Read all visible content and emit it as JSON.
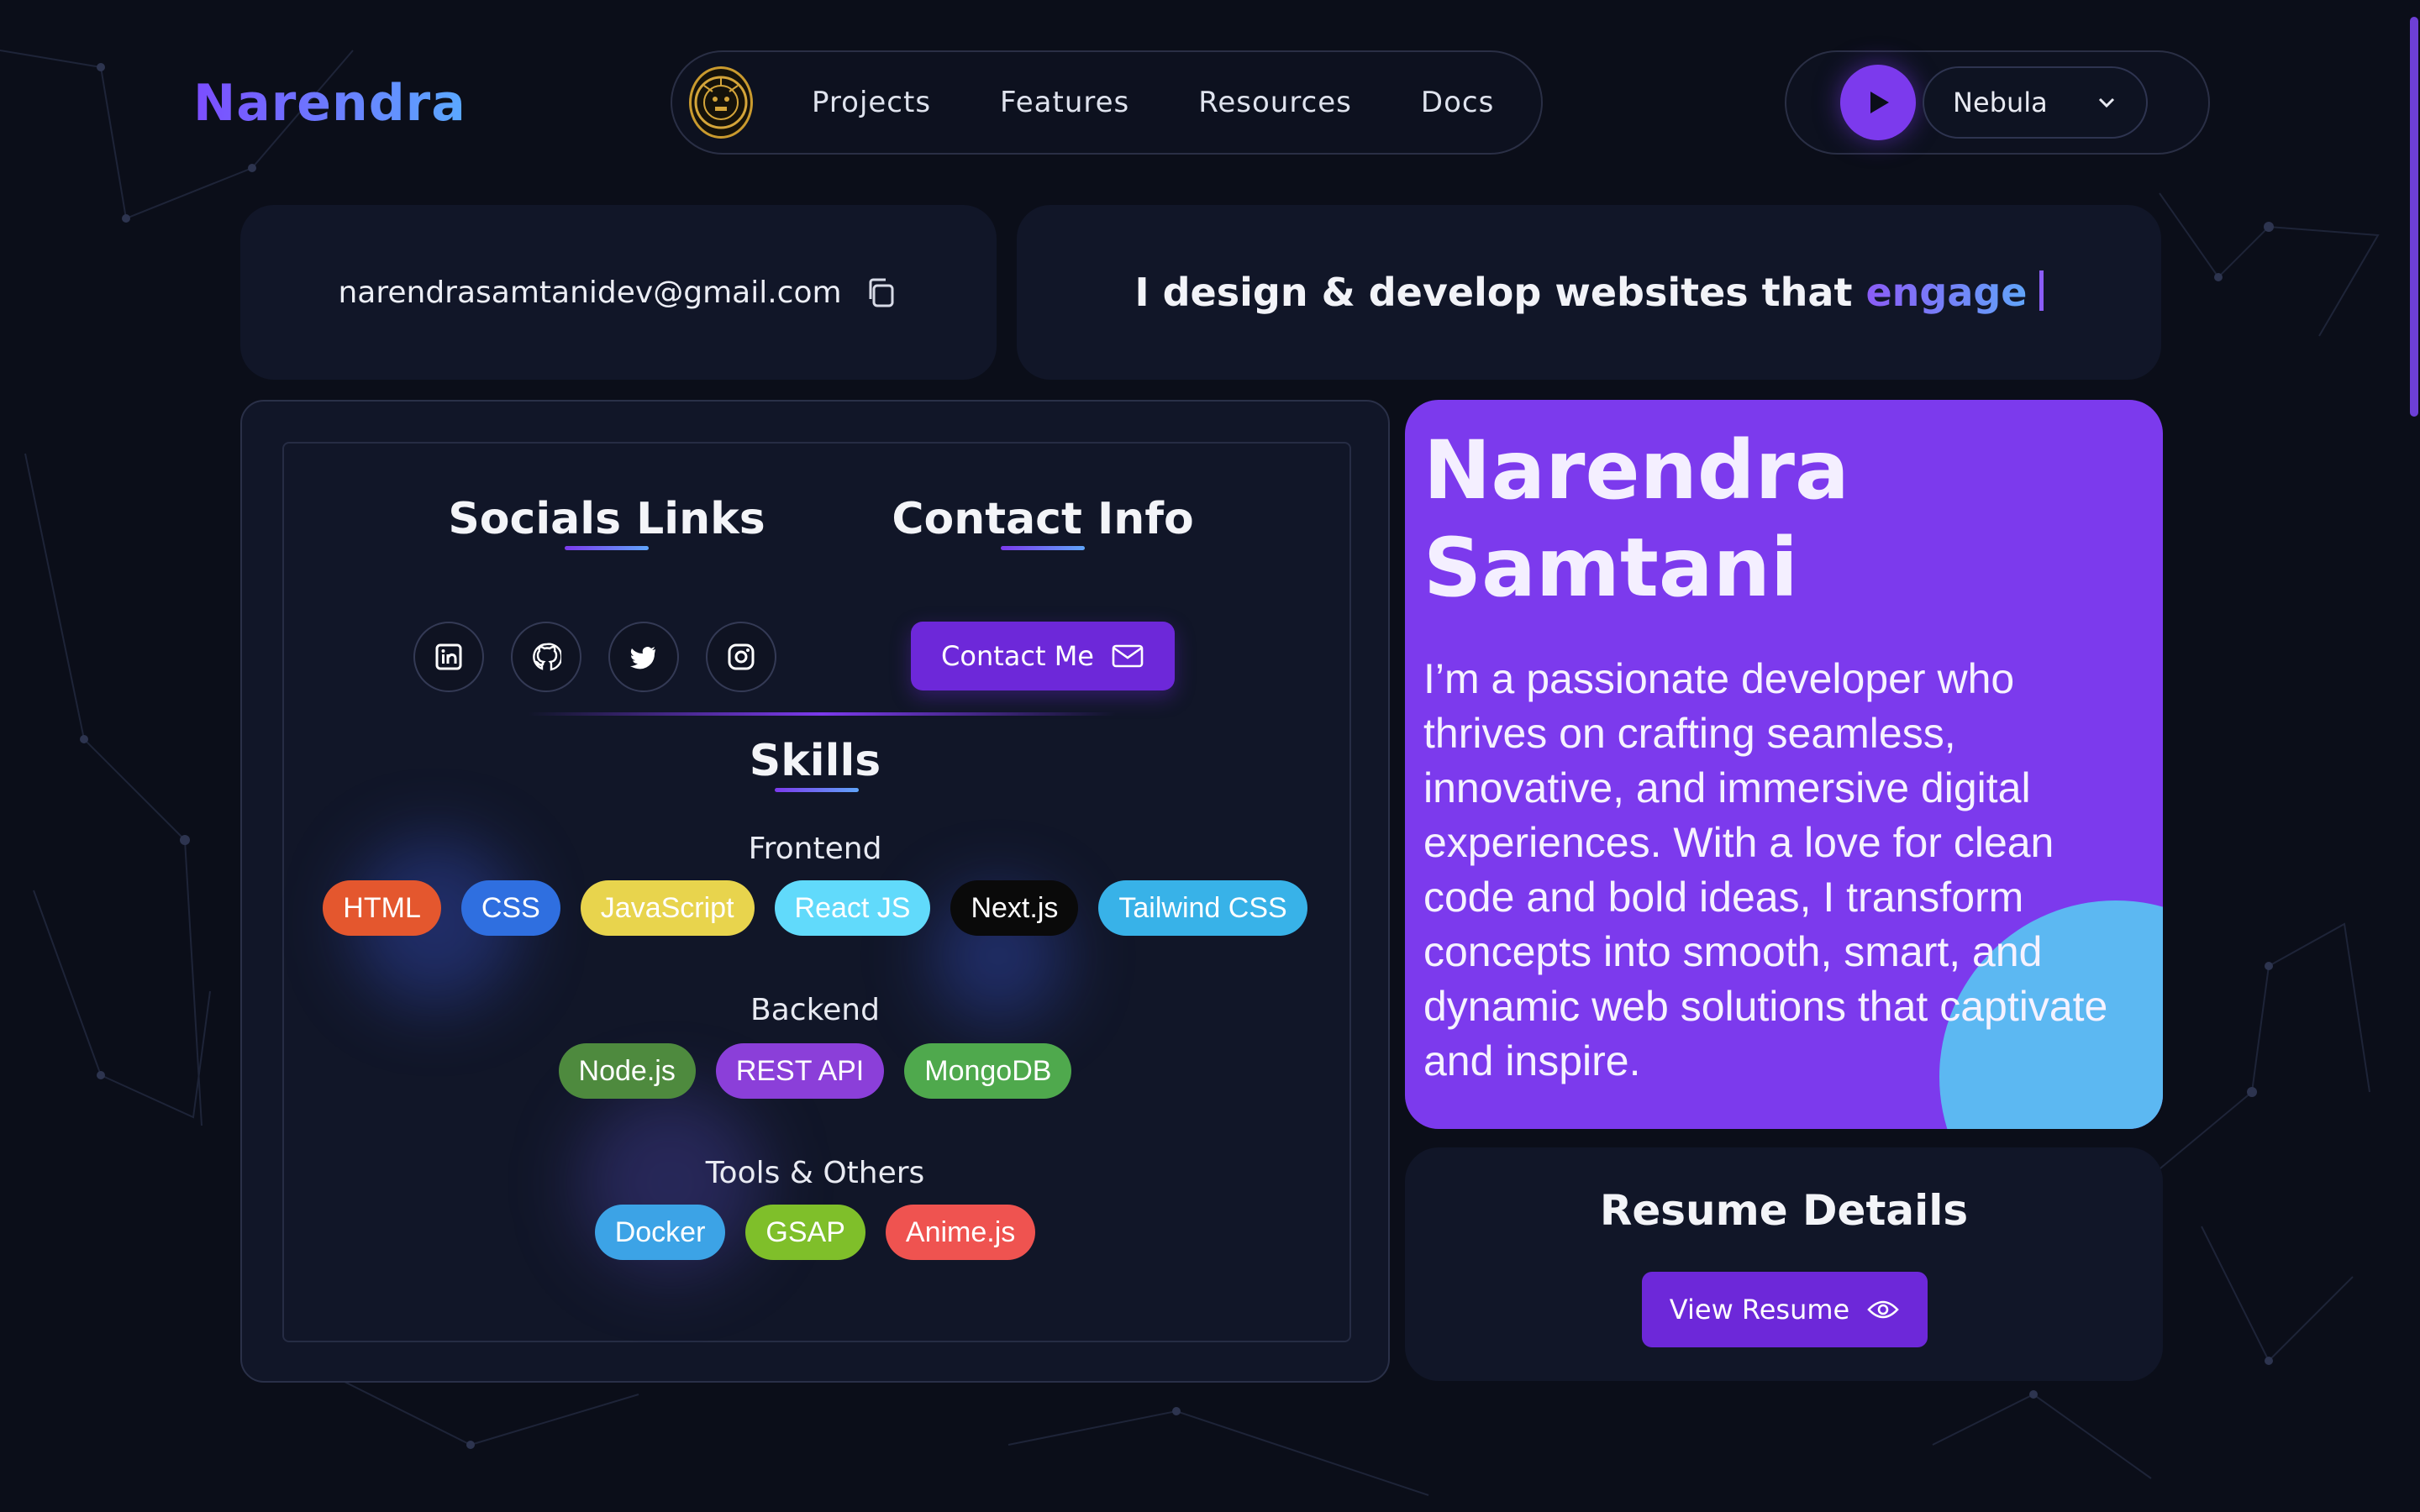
{
  "brand": {
    "logo_text": "Narendra"
  },
  "nav": {
    "items": [
      "Projects",
      "Features",
      "Resources",
      "Docs"
    ]
  },
  "player": {
    "theme_selected": "Nebula"
  },
  "email": {
    "address": "narendrasamtanidev@gmail.com"
  },
  "tagline": {
    "text": "I design & develop websites that ",
    "highlight": "engage"
  },
  "socials": {
    "title": "Socials Links",
    "icons": [
      "linkedin-icon",
      "github-icon",
      "twitter-icon",
      "instagram-icon"
    ]
  },
  "contact": {
    "title": "Contact Info",
    "button_label": "Contact Me"
  },
  "skills": {
    "title": "Skills",
    "groups": [
      {
        "label": "Frontend",
        "tags": [
          {
            "name": "HTML",
            "color": "#e4572e"
          },
          {
            "name": "CSS",
            "color": "#2f6fe0"
          },
          {
            "name": "JavaScript",
            "color": "#e8d44d"
          },
          {
            "name": "React JS",
            "color": "#61dafb"
          },
          {
            "name": "Next.js",
            "color": "#0a0a0a"
          },
          {
            "name": "Tailwind CSS",
            "color": "#38b2e8"
          }
        ]
      },
      {
        "label": "Backend",
        "tags": [
          {
            "name": "Node.js",
            "color": "#4e8a3e"
          },
          {
            "name": "REST API",
            "color": "#8b3fd9"
          },
          {
            "name": "MongoDB",
            "color": "#4fa94d"
          }
        ]
      },
      {
        "label": "Tools & Others",
        "tags": [
          {
            "name": "Docker",
            "color": "#3ca3e6"
          },
          {
            "name": "GSAP",
            "color": "#7fbf2a"
          },
          {
            "name": "Anime.js",
            "color": "#ef5350"
          }
        ]
      }
    ]
  },
  "bio": {
    "name_line1": "Narendra",
    "name_line2": "Samtani",
    "text": "I’m a passionate developer who thrives on crafting seamless, innovative, and immersive digital experiences. With a love for clean code and bold ideas, I transform concepts into smooth, smart, and dynamic web solutions that captivate and inspire."
  },
  "resume": {
    "title": "Resume Details",
    "button_label": "View Resume"
  },
  "colors": {
    "accent": "#7c3aed",
    "accent_blue": "#60a5fa",
    "background": "#0b0e19",
    "card": "#111628"
  }
}
